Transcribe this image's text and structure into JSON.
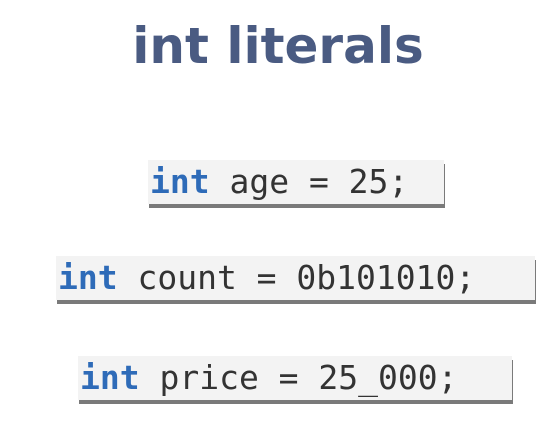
{
  "title": "int literals",
  "colors": {
    "title": "#4a5b82",
    "keyword": "#2e6bb8",
    "code_text": "#333333",
    "code_background": "#f3f3f3",
    "shadow": "#7a7a7a"
  },
  "code_lines": [
    {
      "keyword": "int",
      "rest": " age = 25;"
    },
    {
      "keyword": "int",
      "rest": " count = 0b101010;"
    },
    {
      "keyword": "int",
      "rest": " price = 25_000;"
    }
  ]
}
